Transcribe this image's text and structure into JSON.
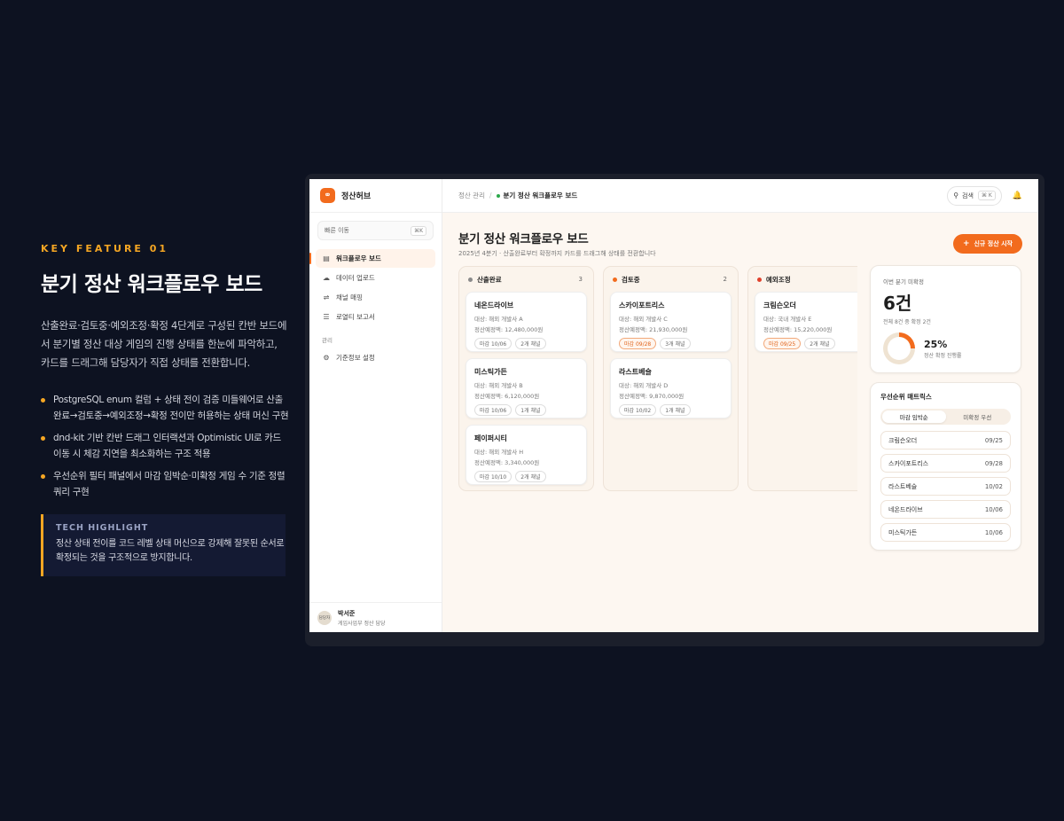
{
  "promo": {
    "kicker": "KEY FEATURE 01",
    "title": "분기 정산 워크플로우 보드",
    "description": "산출완료·검토중·예외조정·확정 4단계로 구성된 칸반 보드에서 분기별 정산 대상 게임의 진행 상태를 한눈에 파악하고, 카드를 드래그해 담당자가 직접 상태를 전환합니다.",
    "bullets": [
      "PostgreSQL enum 컬럼 + 상태 전이 검증 미들웨어로 산출완료→검토중→예외조정→확정 전이만 허용하는 상태 머신 구현",
      "dnd-kit 기반 칸반 드래그 인터랙션과 Optimistic UI로 카드 이동 시 체감 지연을 최소화하는 구조 적용",
      "우선순위 필터 패널에서 마감 임박순·미확정 게임 수 기준 정렬 쿼리 구현"
    ],
    "highlight_title": "TECH HIGHLIGHT",
    "highlight_body": "정산 상태 전이를 코드 레벨 상태 머신으로 강제해 잘못된 순서로 확정되는 것을 구조적으로 방지합니다."
  },
  "app": {
    "brand": "정산허브",
    "quick_label": "빠른 이동",
    "quick_kbd": "⌘K",
    "nav": [
      {
        "label": "워크플로우 보드",
        "icon": "board-icon"
      },
      {
        "label": "데이터 업로드",
        "icon": "upload-icon"
      },
      {
        "label": "채널 매핑",
        "icon": "shuffle-icon"
      },
      {
        "label": "로열티 보고서",
        "icon": "document-icon"
      }
    ],
    "section_label": "관리",
    "settings_label": "기준정보 설정",
    "user": {
      "avatar": "담당자",
      "name": "박서준",
      "role": "게임사업부 정산 담당"
    },
    "breadcrumb": {
      "parent": "정산 관리",
      "separator": "/",
      "current": "분기 정산 워크플로우 보드"
    },
    "search_label": "검색",
    "search_kbd": "⌘ K",
    "page_title": "분기 정산 워크플로우 보드",
    "page_subtitle": "2025년 4분기 · 산출완료부터 확정까지 카드를 드래그해 상태를 전환합니다",
    "new_button": "신규 정산 시작",
    "colors": {
      "accent": "#f26b1d",
      "done": "#888888",
      "review": "#f26b1d",
      "exception": "#e0412c"
    },
    "columns": [
      {
        "title": "산출완료",
        "count": "3",
        "cards": [
          {
            "title": "네온드라이브",
            "target": "대상: 해외 개발사 A",
            "amount": "정산예정액: 12,480,000원",
            "due": "마감 10/06",
            "channels": "2개 채널",
            "urgent": false
          },
          {
            "title": "미스틱가든",
            "target": "대상: 해외 개발사 B",
            "amount": "정산예정액: 6,120,000원",
            "due": "마감 10/06",
            "channels": "1개 채널",
            "urgent": false
          },
          {
            "title": "페이퍼시티",
            "target": "대상: 해외 개발사 H",
            "amount": "정산예정액: 3,340,000원",
            "due": "마감 10/10",
            "channels": "2개 채널",
            "urgent": false
          }
        ]
      },
      {
        "title": "검토중",
        "count": "2",
        "cards": [
          {
            "title": "스카이포트리스",
            "target": "대상: 해외 개발사 C",
            "amount": "정산예정액: 21,930,000원",
            "due": "마감 09/28",
            "channels": "3개 채널",
            "urgent": true
          },
          {
            "title": "라스트베슬",
            "target": "대상: 해외 개발사 D",
            "amount": "정산예정액: 9,870,000원",
            "due": "마감 10/02",
            "channels": "1개 채널",
            "urgent": false
          }
        ]
      },
      {
        "title": "예외조정",
        "count": "",
        "cards": [
          {
            "title": "크림슨오더",
            "target": "대상: 국내 개발사 E",
            "amount": "정산예정액: 15,220,000원",
            "due": "마감 09/25",
            "channels": "2개 채널",
            "urgent": true
          }
        ]
      }
    ],
    "stat": {
      "label": "이번 분기 미확정",
      "value": "6건",
      "sub": "전체 8건 중 확정 2건",
      "percent_label": "25%",
      "percent_value": 25,
      "percent_caption": "정산 확정 진행률"
    },
    "matrix": {
      "title": "우선순위 매트릭스",
      "tabs": [
        "마감 임박순",
        "미확정 우선"
      ],
      "rows": [
        {
          "name": "크림슨오더",
          "date": "09/25"
        },
        {
          "name": "스카이포트리스",
          "date": "09/28"
        },
        {
          "name": "라스트베슬",
          "date": "10/02"
        },
        {
          "name": "네온드라이브",
          "date": "10/06"
        },
        {
          "name": "미스틱가든",
          "date": "10/06"
        }
      ]
    }
  }
}
